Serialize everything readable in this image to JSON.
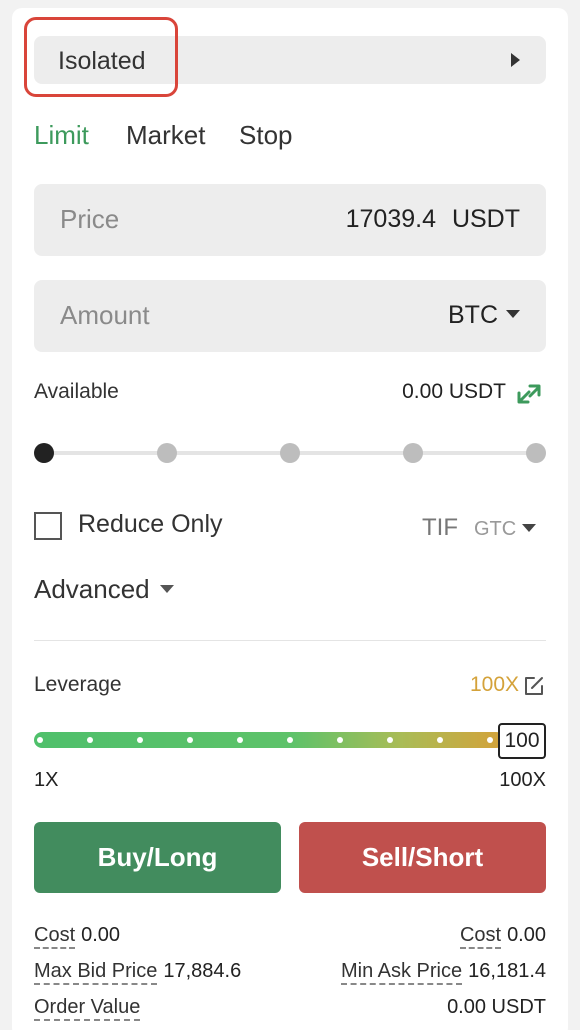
{
  "margin_mode": {
    "label": "Isolated"
  },
  "order_tabs": [
    {
      "label": "Limit",
      "active": true
    },
    {
      "label": "Market",
      "active": false
    },
    {
      "label": "Stop",
      "active": false
    }
  ],
  "price_field": {
    "placeholder": "Price",
    "value": "17039.4",
    "unit": "USDT"
  },
  "amount_field": {
    "placeholder": "Amount",
    "unit": "BTC"
  },
  "available": {
    "label": "Available",
    "value": "0.00 USDT",
    "icon": "transfer-icon"
  },
  "amount_slider": {
    "steps": 5,
    "selected_index": 0
  },
  "reduce_only": {
    "label": "Reduce Only",
    "checked": false
  },
  "tif": {
    "label": "TIF",
    "value": "GTC"
  },
  "advanced": {
    "label": "Advanced"
  },
  "leverage": {
    "label": "Leverage",
    "value": "100X",
    "handle_value": "100",
    "min_label": "1X",
    "max_label": "100X",
    "level_fraction": 1.0
  },
  "buttons": {
    "buy": "Buy/Long",
    "sell": "Sell/Short"
  },
  "info": {
    "cost_left": {
      "label": "Cost",
      "value": "0.00"
    },
    "cost_right": {
      "label": "Cost",
      "value": "0.00"
    },
    "max_bid": {
      "label": "Max Bid Price",
      "value": "17,884.6"
    },
    "min_ask": {
      "label": "Min Ask Price",
      "value": "16,181.4"
    },
    "order_value": {
      "label": "Order Value",
      "value": "0.00 USDT"
    }
  },
  "colors": {
    "accent_green": "#3d9a5c",
    "buy": "#428c5e",
    "sell": "#c0504d",
    "leverage_gold": "#d4a23a",
    "highlight_red": "#d9453a"
  }
}
